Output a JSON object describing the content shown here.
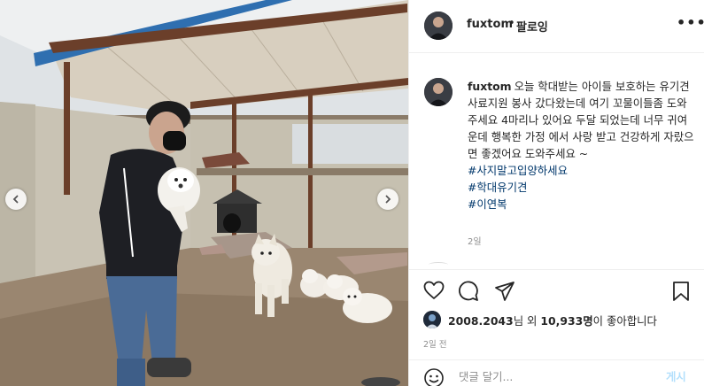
{
  "header": {
    "username": "fuxtom",
    "separator": "•",
    "follow_label": "팔로잉",
    "more_label": "•••"
  },
  "caption": {
    "username": "fuxtom",
    "text": "오늘 학대받는 아이들 보호하는 유기견 사료지원 봉사 갔다왔는데 여기 꼬물이들좀 도와주세요 4마리나 있어요 두달 되었는데 너무 귀여운데 행복한 가정 에서 사랑 받고 건강하게 자랐으면 좋겠어요 도와주세요 ~",
    "hashtags": [
      "#사지말고입양하세요",
      "#학대유기견",
      "#이연복"
    ],
    "age": "2일"
  },
  "likes": {
    "liker": "2008.2043",
    "middle": "님 외",
    "count": "10,933명",
    "suffix": "이 좋아합니다"
  },
  "time_ago": "2일 전",
  "comment": {
    "placeholder": "댓글 달기...",
    "post_label": "게시"
  },
  "icons": {
    "like": "heart-icon",
    "comment": "comment-icon",
    "share": "paper-plane-icon",
    "save": "bookmark-icon",
    "emoji": "emoji-icon",
    "prev": "chevron-left-icon",
    "next": "chevron-right-icon"
  },
  "colors": {
    "hashtag": "#00376b",
    "secondary_text": "#8e8e8e",
    "post_button_disabled": "#b2dffc"
  }
}
